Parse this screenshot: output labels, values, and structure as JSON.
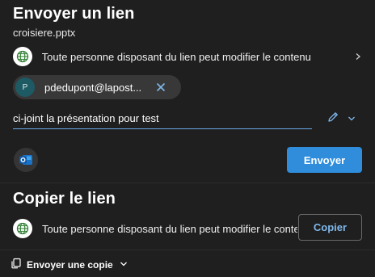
{
  "send_link": {
    "title": "Envoyer un lien",
    "filename": "croisiere.pptx",
    "permission_text": "Toute personne disposant du lien peut modifier le contenu",
    "recipient": {
      "avatar_initial": "P",
      "email": "pdedupont@lapost..."
    },
    "message": "ci-joint la présentation pour test",
    "send_label": "Envoyer"
  },
  "copy_link": {
    "title": "Copier le lien",
    "permission_text": "Toute personne disposant du lien peut modifier le contenu",
    "copy_label": "Copier"
  },
  "footer": {
    "send_copy_label": "Envoyer une copie"
  },
  "colors": {
    "background": "#1f1f1f",
    "accent": "#2f8ddb",
    "link": "#7fb8ec",
    "globe_icon": "#2e7d32",
    "outlook_icon": "#1a73c9"
  },
  "icons": [
    "globe-icon",
    "chevron-right-icon",
    "close-icon",
    "pencil-icon",
    "chevron-down-icon",
    "outlook-icon",
    "copy-icon"
  ]
}
